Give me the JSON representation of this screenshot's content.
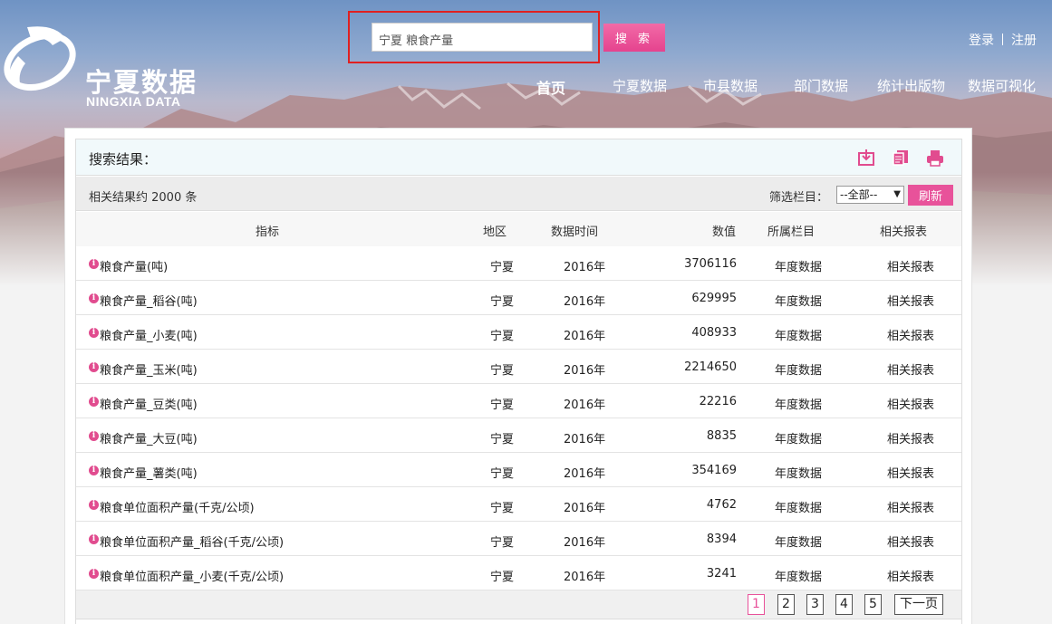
{
  "brand": {
    "name_cn": "宁夏数据",
    "name_en": "NINGXIA DATA"
  },
  "search": {
    "value": "宁夏 粮食产量",
    "button_label": "搜 索"
  },
  "user": {
    "login": "登录",
    "register": "注册"
  },
  "nav": {
    "items": [
      "首页",
      "宁夏数据",
      "市县数据",
      "部门数据",
      "统计出版物",
      "数据可视化"
    ]
  },
  "results": {
    "title": "搜索结果：",
    "count_text": "相关结果约 2000 条",
    "filter_label": "筛选栏目：",
    "filter_value": "--全部--",
    "refresh_label": "刷新",
    "tool_icons": [
      "download-icon",
      "copy-icon",
      "print-icon"
    ],
    "columns": {
      "indicator": "指标",
      "region": "地区",
      "time": "数据时间",
      "value": "数值",
      "category": "所属栏目",
      "reports": "相关报表"
    },
    "rows": [
      {
        "indicator": "粮食产量(吨)",
        "region": "宁夏",
        "time": "2016年",
        "value": "3706116",
        "category": "年度数据",
        "reports": "相关报表"
      },
      {
        "indicator": "粮食产量_稻谷(吨)",
        "region": "宁夏",
        "time": "2016年",
        "value": "629995",
        "category": "年度数据",
        "reports": "相关报表"
      },
      {
        "indicator": "粮食产量_小麦(吨)",
        "region": "宁夏",
        "time": "2016年",
        "value": "408933",
        "category": "年度数据",
        "reports": "相关报表"
      },
      {
        "indicator": "粮食产量_玉米(吨)",
        "region": "宁夏",
        "time": "2016年",
        "value": "2214650",
        "category": "年度数据",
        "reports": "相关报表"
      },
      {
        "indicator": "粮食产量_豆类(吨)",
        "region": "宁夏",
        "time": "2016年",
        "value": "22216",
        "category": "年度数据",
        "reports": "相关报表"
      },
      {
        "indicator": "粮食产量_大豆(吨)",
        "region": "宁夏",
        "time": "2016年",
        "value": "8835",
        "category": "年度数据",
        "reports": "相关报表"
      },
      {
        "indicator": "粮食产量_薯类(吨)",
        "region": "宁夏",
        "time": "2016年",
        "value": "354169",
        "category": "年度数据",
        "reports": "相关报表"
      },
      {
        "indicator": "粮食单位面积产量(千克/公顷)",
        "region": "宁夏",
        "time": "2016年",
        "value": "4762",
        "category": "年度数据",
        "reports": "相关报表"
      },
      {
        "indicator": "粮食单位面积产量_稻谷(千克/公顷)",
        "region": "宁夏",
        "time": "2016年",
        "value": "8394",
        "category": "年度数据",
        "reports": "相关报表"
      },
      {
        "indicator": "粮食单位面积产量_小麦(千克/公顷)",
        "region": "宁夏",
        "time": "2016年",
        "value": "3241",
        "category": "年度数据",
        "reports": "相关报表"
      }
    ]
  },
  "pager": {
    "pages": [
      "1",
      "2",
      "3",
      "4",
      "5"
    ],
    "current": "1",
    "next_label": "下一页"
  },
  "colors": {
    "accent": "#e8529a",
    "highlight_border": "#e02020"
  }
}
